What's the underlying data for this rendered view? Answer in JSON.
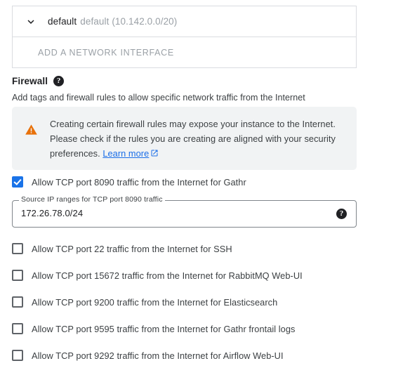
{
  "network_interface": {
    "chevron_icon": "chevron-down-icon",
    "name": "default",
    "details": "default (10.142.0.0/20)",
    "add_label": "ADD A NETWORK INTERFACE"
  },
  "firewall": {
    "title": "Firewall",
    "help_icon": "help-icon",
    "description": "Add tags and firewall rules to allow specific network traffic from the Internet",
    "warning": {
      "icon": "warning-triangle-icon",
      "text": "Creating certain firewall rules may expose your instance to the Internet. Please check if the rules you are creating are aligned with your security preferences. ",
      "link_label": "Learn more",
      "link_icon": "external-link-icon",
      "background": "#f1f3f4",
      "icon_color": "#e8710a"
    },
    "rules": [
      {
        "label": "Allow TCP port 8090 traffic from the Internet for Gathr",
        "checked": true
      },
      {
        "label": "Allow TCP port 22 traffic from the Internet for SSH",
        "checked": false
      },
      {
        "label": "Allow TCP port 15672 traffic from the Internet for RabbitMQ Web-UI",
        "checked": false
      },
      {
        "label": "Allow TCP port 9200 traffic from the Internet for Elasticsearch",
        "checked": false
      },
      {
        "label": "Allow TCP port 9595 traffic from the Internet for Gathr frontail logs",
        "checked": false
      },
      {
        "label": "Allow TCP port 9292 traffic from the Internet for Airflow Web-UI",
        "checked": false
      }
    ],
    "source_ip_field": {
      "label": "Source IP ranges for TCP port 8090 traffic",
      "value": "172.26.78.0/24",
      "placeholder": "",
      "help_icon": "help-icon"
    }
  },
  "colors": {
    "accent": "#1a73e8",
    "link": "#1a6ee8",
    "warning": "#e8710a",
    "border": "#dadce0",
    "text": "#3c4043",
    "muted": "#9aa0a6"
  }
}
